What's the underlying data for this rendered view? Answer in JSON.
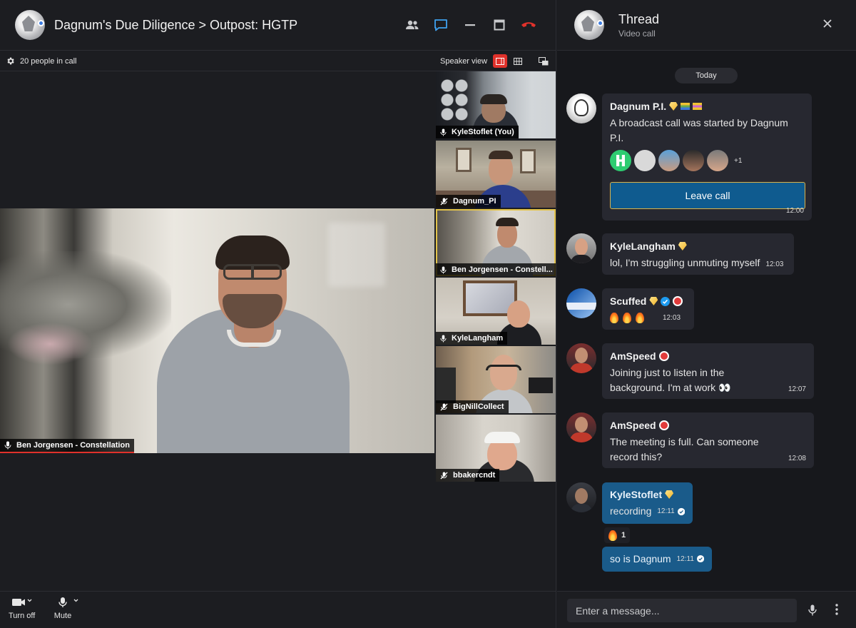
{
  "call": {
    "title": "Dagnum's Due Diligence > Outpost: HGTP",
    "people_count": "20 people in call",
    "speaker_view_label": "Speaker view",
    "main_speaker": "Ben Jorgensen - Constellation",
    "tiles": [
      {
        "name": "KyleStoflet (You)"
      },
      {
        "name": "Dagnum_PI"
      },
      {
        "name": "Ben Jorgensen - Constell..."
      },
      {
        "name": "KyleLangham"
      },
      {
        "name": "BigNillCollect"
      },
      {
        "name": "bbakercndt"
      }
    ],
    "controls": {
      "video_label": "Turn off",
      "mic_label": "Mute"
    }
  },
  "thread": {
    "title": "Thread",
    "subtitle": "Video call",
    "date_pill": "Today",
    "messages": [
      {
        "author": "Dagnum P.I.",
        "text": "A broadcast call was started by Dagnum P.I.",
        "extra_count": "+1",
        "button": "Leave call",
        "time": "12:00"
      },
      {
        "author": "KyleLangham",
        "text": "lol, I'm struggling unmuting myself",
        "time": "12:03"
      },
      {
        "author": "Scuffed",
        "time": "12:03"
      },
      {
        "author": "AmSpeed",
        "text": "Joining just to listen in the background. I'm at work 👀",
        "time": "12:07"
      },
      {
        "author": "AmSpeed",
        "text": "The meeting is full. Can someone record this?",
        "time": "12:08"
      },
      {
        "author": "KyleStoflet",
        "text": "recording",
        "time": "12:11",
        "reaction_count": "1"
      },
      {
        "text": "so is Dagnum",
        "time": "12:11"
      }
    ],
    "composer_placeholder": "Enter a message..."
  },
  "colors": {
    "accent_blue": "#1a5b8a",
    "hangup_red": "#e0312b",
    "active_tile": "#e3c34a"
  }
}
